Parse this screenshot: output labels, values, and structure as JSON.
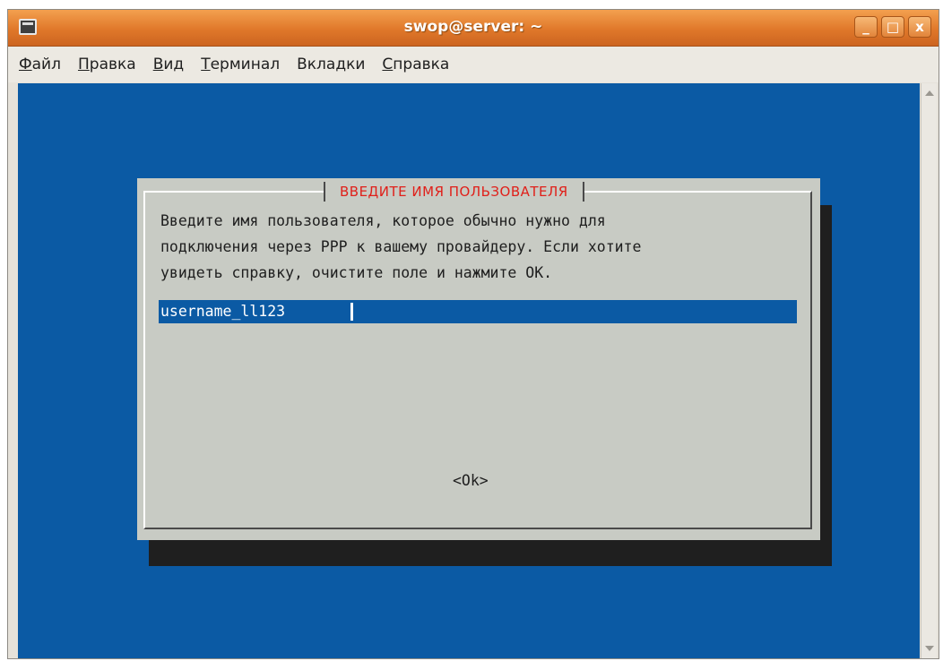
{
  "window": {
    "title": "swop@server: ~",
    "buttons": {
      "minimize": "_",
      "maximize": "□",
      "close": "x"
    }
  },
  "menu": [
    {
      "mnemonic": "Ф",
      "rest": "айл"
    },
    {
      "mnemonic": "П",
      "rest": "равка"
    },
    {
      "mnemonic": "В",
      "rest": "ид"
    },
    {
      "mnemonic": "Т",
      "rest": "ерминал"
    },
    {
      "pre": "Вкла",
      "mnemonic": "д",
      "rest": "ки"
    },
    {
      "mnemonic": "С",
      "rest": "правка"
    }
  ],
  "dialog": {
    "title": "ВВЕДИТЕ ИМЯ ПОЛЬЗОВАТЕЛЯ",
    "lines": [
      "Введите имя пользователя, которое обычно нужно для",
      "подключения через PPP к вашему провайдеру. Если хотите",
      "увидеть справку, очистите поле и нажмите OK."
    ],
    "input_value": "username_ll123",
    "ok_label": "<Ok>"
  },
  "colors": {
    "titlebar": "#e0782a",
    "terminal_bg": "#0b5aa4",
    "dialog_bg": "#c8cbc4",
    "dialog_title": "#e0201a"
  }
}
